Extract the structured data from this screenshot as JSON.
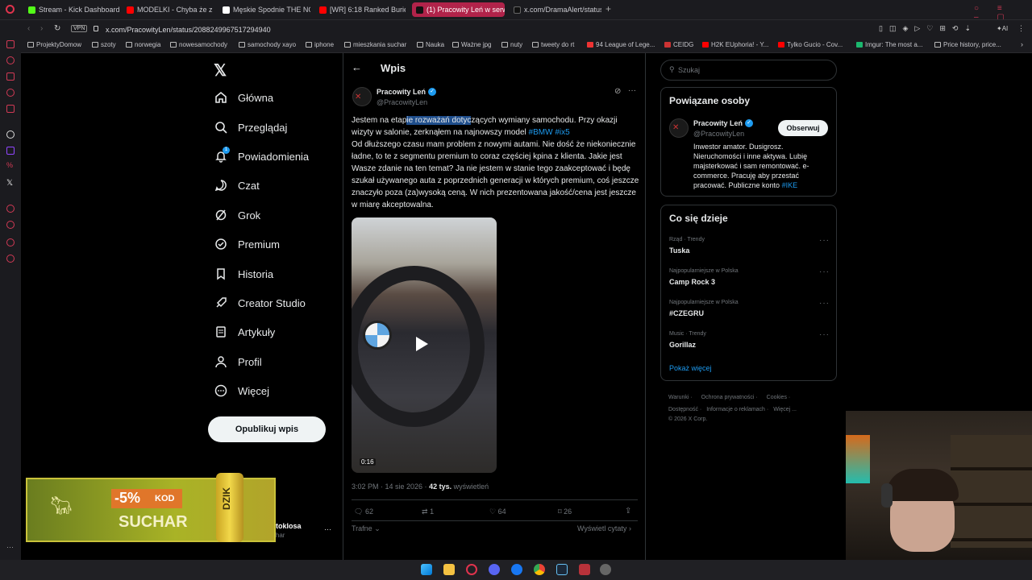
{
  "tabs": [
    {
      "label": "Stream - Kick Dashboard",
      "color": "#53fc18"
    },
    {
      "label": "MODELKI - Chyba że z Te",
      "color": "#ff0000"
    },
    {
      "label": "Męskie Spodnie THE NOR",
      "color": "#ffffff"
    },
    {
      "label": "[WR] 6:18 Ranked Buried T",
      "color": "#ff0000"
    },
    {
      "label": "(1) Pracowity Leń w serwis",
      "color": "#ffffff"
    },
    {
      "label": "x.com/DramaAlert/status/2",
      "color": "#ffffff"
    }
  ],
  "address": {
    "vpn": "VPN",
    "url": "x.com/PracowityLen/status/2088249967517294940"
  },
  "bookmarks": [
    "ProjektyDomow",
    "szoty",
    "norwegia",
    "nowesamochody",
    "samochody xayo",
    "iphone",
    "mieszkania suchar",
    "Nauka",
    "Ważne jpg",
    "nuty",
    "tweety do rt",
    "94 League of Lege...",
    "CEIDG",
    "H2K EUphoria! - Y...",
    "Tylko Gucio - Cov...",
    "Imgur: The most a...",
    "Price history, price..."
  ],
  "nav": {
    "items": [
      "Główna",
      "Przeglądaj",
      "Powiadomienia",
      "Czat",
      "Grok",
      "Premium",
      "Historia",
      "Creator Studio",
      "Artykuły",
      "Profil",
      "Więcej"
    ],
    "notif_badge": "1",
    "publish": "Opublikuj wpis"
  },
  "account": {
    "name": "Dominik Stoklosa",
    "handle": "@NieSuchar"
  },
  "post": {
    "header_title": "Wpis",
    "author_name": "Pracowity Leń",
    "author_handle": "@PracowityLen",
    "text_before": "Jestem na etap",
    "text_selected": "ie rozważań dotyc",
    "text_mid": "zących wymiany samochodu. Przy okazji wizyty w salonie, zerknąłem na najnowszy model ",
    "hashtags": "#BMW #ix5",
    "text_after": "Od dłuższego czasu mam problem z nowymi autami. Nie dość że niekoniecznie ładne, to te z segmentu premium to coraz częściej kpina z klienta. Jakie jest Wasze zdanie na ten temat? Ja nie jestem w stanie tego zaakceptować i będę szukał używanego auta z poprzednich generacji w których premium, coś jeszcze znaczyło poza (za)wysoką ceną. W nich prezentowana jakość/cena jest jeszcze w miarę akceptowalna.",
    "video_duration": "0:16",
    "time": "3:02 PM · 14 sie 2026 · ",
    "views_count": "42 tys.",
    "views_label": "wyświetleń",
    "replies": "62",
    "reposts": "1",
    "likes": "64",
    "bookmarks": "26",
    "sort_label": "Trafne",
    "quotes_label": "Wyświetl cytaty"
  },
  "search": {
    "placeholder": "Szukaj"
  },
  "related": {
    "title": "Powiązane osoby",
    "name": "Pracowity Leń",
    "handle": "@PracowityLen",
    "follow": "Obserwuj",
    "bio": "Inwestor amator. Dusigrosz. Nieruchomości i inne aktywa. Lubię majsterkować i sam remontować. e-commerce. Pracuję aby przestać pracować. Publiczne konto ",
    "bio_tag": "#IKE"
  },
  "trends": {
    "title": "Co się dzieje",
    "items": [
      {
        "meta": "Rząd · Trendy",
        "name": "Tuska"
      },
      {
        "meta": "Najpopularniejsze w Polska",
        "name": "Camp Rock 3"
      },
      {
        "meta": "Najpopularniejsze w Polska",
        "name": "#CZEGRU"
      },
      {
        "meta": "Music · Trendy",
        "name": "Gorillaz"
      }
    ],
    "more": "Pokaż więcej"
  },
  "footer": {
    "line1": [
      "Warunki",
      "Ochrona prywatności",
      "Cookies"
    ],
    "line2": [
      "Dostępność",
      "Informacje o reklamach",
      "Więcej ..."
    ],
    "copy": "© 2026 X Corp."
  },
  "overlay": {
    "discount": "-5%",
    "kod": "KOD",
    "code": "SUCHAR",
    "brand": "DZIK"
  },
  "colors": {
    "accent": "#1d9bf0",
    "selection": "#1f4e8c",
    "bg": "#000000",
    "opera_red": "#d23a55"
  }
}
